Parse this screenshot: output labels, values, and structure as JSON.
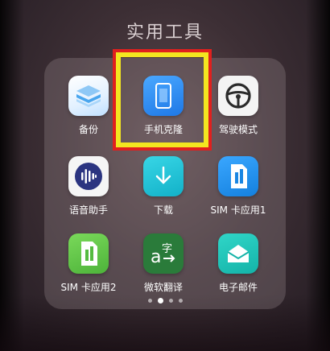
{
  "folder": {
    "title": "实用工具",
    "apps": [
      {
        "label": "备份",
        "icon": "backup-icon",
        "color": "#cfe6ff"
      },
      {
        "label": "手机克隆",
        "icon": "phone-clone-icon",
        "color": "#2f8ff0"
      },
      {
        "label": "驾驶模式",
        "icon": "steering-wheel-icon",
        "color": "#f2f2f2"
      },
      {
        "label": "语音助手",
        "icon": "voice-assistant-icon",
        "color": "#f4f4f4"
      },
      {
        "label": "下载",
        "icon": "download-icon",
        "color": "#1fc3d6"
      },
      {
        "label": "SIM 卡应用1",
        "icon": "sim-card-1-icon",
        "color": "#1f90e8"
      },
      {
        "label": "SIM 卡应用2",
        "icon": "sim-card-2-icon",
        "color": "#62c846"
      },
      {
        "label": "微软翻译",
        "icon": "translator-icon",
        "color": "#2a7b3a"
      },
      {
        "label": "电子邮件",
        "icon": "email-icon",
        "color": "#20c4b8"
      }
    ],
    "page_indicator": {
      "count": 4,
      "active": 2
    }
  },
  "highlight": {
    "target": "手机克隆",
    "inner_color": "#f3e620",
    "outer_color": "#e0201e"
  }
}
